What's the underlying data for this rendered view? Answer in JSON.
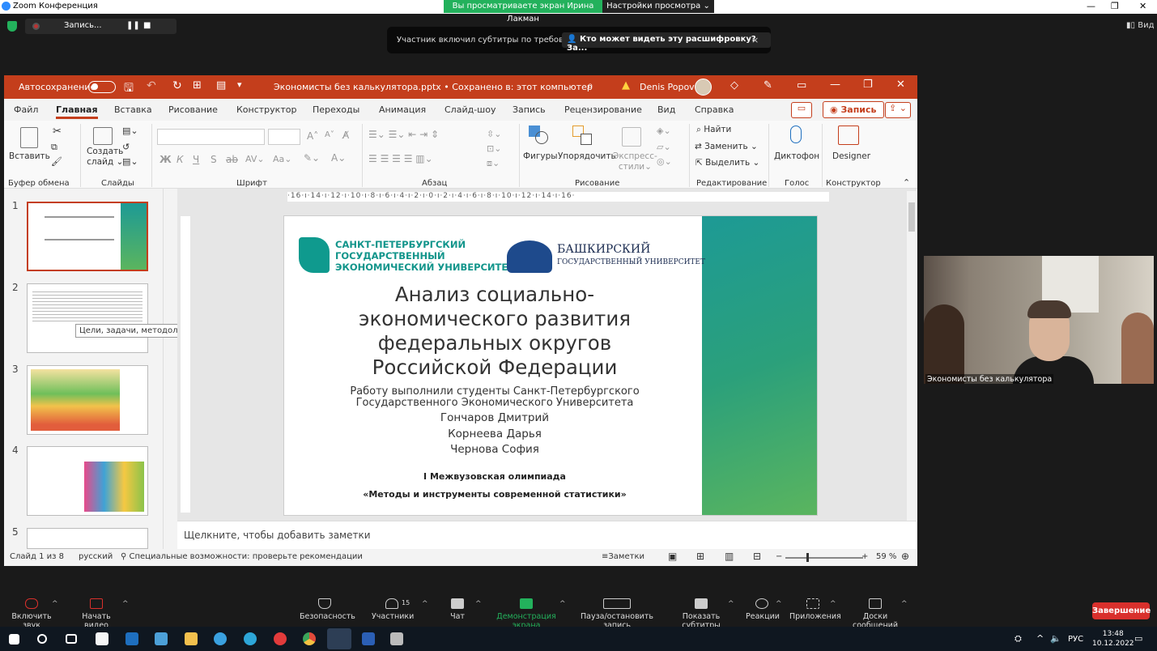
{
  "window": {
    "title": "Zoom Конференция"
  },
  "share_banner": {
    "text": "Вы просматриваете экран Ирина Лакман",
    "view_options": "Настройки просмотра"
  },
  "recording": {
    "label": "Запись..."
  },
  "caption_notice": {
    "text": "Участник включил субтитры по требованию",
    "link": "Кто может видеть эту расшифровку? За...",
    "close": "×"
  },
  "view_label": "Вид",
  "powerpoint": {
    "autosave_label": "Автосохранение",
    "filename": "Экономисты без калькулятора.pptx • Сохранено в: этот компьютер",
    "user": "Denis Popov",
    "tabs": [
      "Файл",
      "Главная",
      "Вставка",
      "Рисование",
      "Конструктор",
      "Переходы",
      "Анимация",
      "Слайд-шоу",
      "Запись",
      "Рецензирование",
      "Вид",
      "Справка"
    ],
    "active_tab": "Главная",
    "record_button": "Запись",
    "ribbon": {
      "paste": "Вставить",
      "create_slide_1": "Создать",
      "create_slide_2": "слайд",
      "shapes": "Фигуры",
      "arrange": "Упорядочить",
      "quick_styles_1": "Экспресс-",
      "quick_styles_2": "стили",
      "find": "Найти",
      "replace": "Заменить",
      "select": "Выделить",
      "dictate": "Диктофон",
      "designer": "Designer",
      "groups": [
        "Буфер обмена",
        "Слайды",
        "Шрифт",
        "Абзац",
        "Рисование",
        "Редактирование",
        "Голос",
        "Конструктор"
      ]
    },
    "thumbnail_numbers": [
      "1",
      "2",
      "3",
      "4",
      "5"
    ],
    "tooltip": "Цели, задачи, методология и...",
    "ruler_text": "·16·ı·14·ı·12·ı·10·ı·8·ı·6·ı·4·ı·2·ı·0·ı·2·ı·4·ı·6·ı·8·ı·10·ı·12·ı·14·ı·16·",
    "slide": {
      "spbu_line1": "САНКТ-ПЕТЕРБУРГСКИЙ",
      "spbu_line2": "ГОСУДАРСТВЕННЫЙ",
      "spbu_line3": "ЭКОНОМИЧЕСКИЙ УНИВЕРСИТЕТ",
      "bsu_line1": "БАШКИРСКИЙ",
      "bsu_line2": "ГОСУДАРСТВЕННЫЙ УНИВЕРСИТЕТ",
      "title_lines": [
        "Анализ социально-",
        "экономического развития",
        "федеральных округов",
        "Российской Федерации"
      ],
      "subtitle_lines": [
        "Работу выполнили студенты Санкт-Петербургского",
        "Государственного Экономического Университета"
      ],
      "names": [
        "Гончаров Дмитрий",
        "Корнеева Дарья",
        "Чернова София"
      ],
      "olympiad": "I Межвузовская олимпиада",
      "olympiad_name": "«Методы и инструменты современной статистики»"
    },
    "notes_placeholder": "Щелкните, чтобы добавить заметки",
    "status": {
      "slide": "Слайд 1 из 8",
      "language": "русский",
      "accessibility": "Специальные возможности: проверьте рекомендации",
      "notes": "Заметки",
      "zoom": "59 %"
    }
  },
  "video": {
    "name": "Экономисты без калькулятора"
  },
  "toolbar": {
    "mute": "Включить звук",
    "video": "Начать видео",
    "security": "Безопасность",
    "participants": "Участники",
    "participant_count": "15",
    "chat": "Чат",
    "share": "Демонстрация экрана",
    "pause_rec": "Пауза/остановить запись",
    "subtitles": "Показать субтитры",
    "reactions": "Реакции",
    "apps": "Приложения",
    "whiteboards": "Доски сообщений",
    "end": "Завершение"
  },
  "taskbar": {
    "lang": "РУС",
    "time": "13:48",
    "date": "10.12.2022"
  }
}
